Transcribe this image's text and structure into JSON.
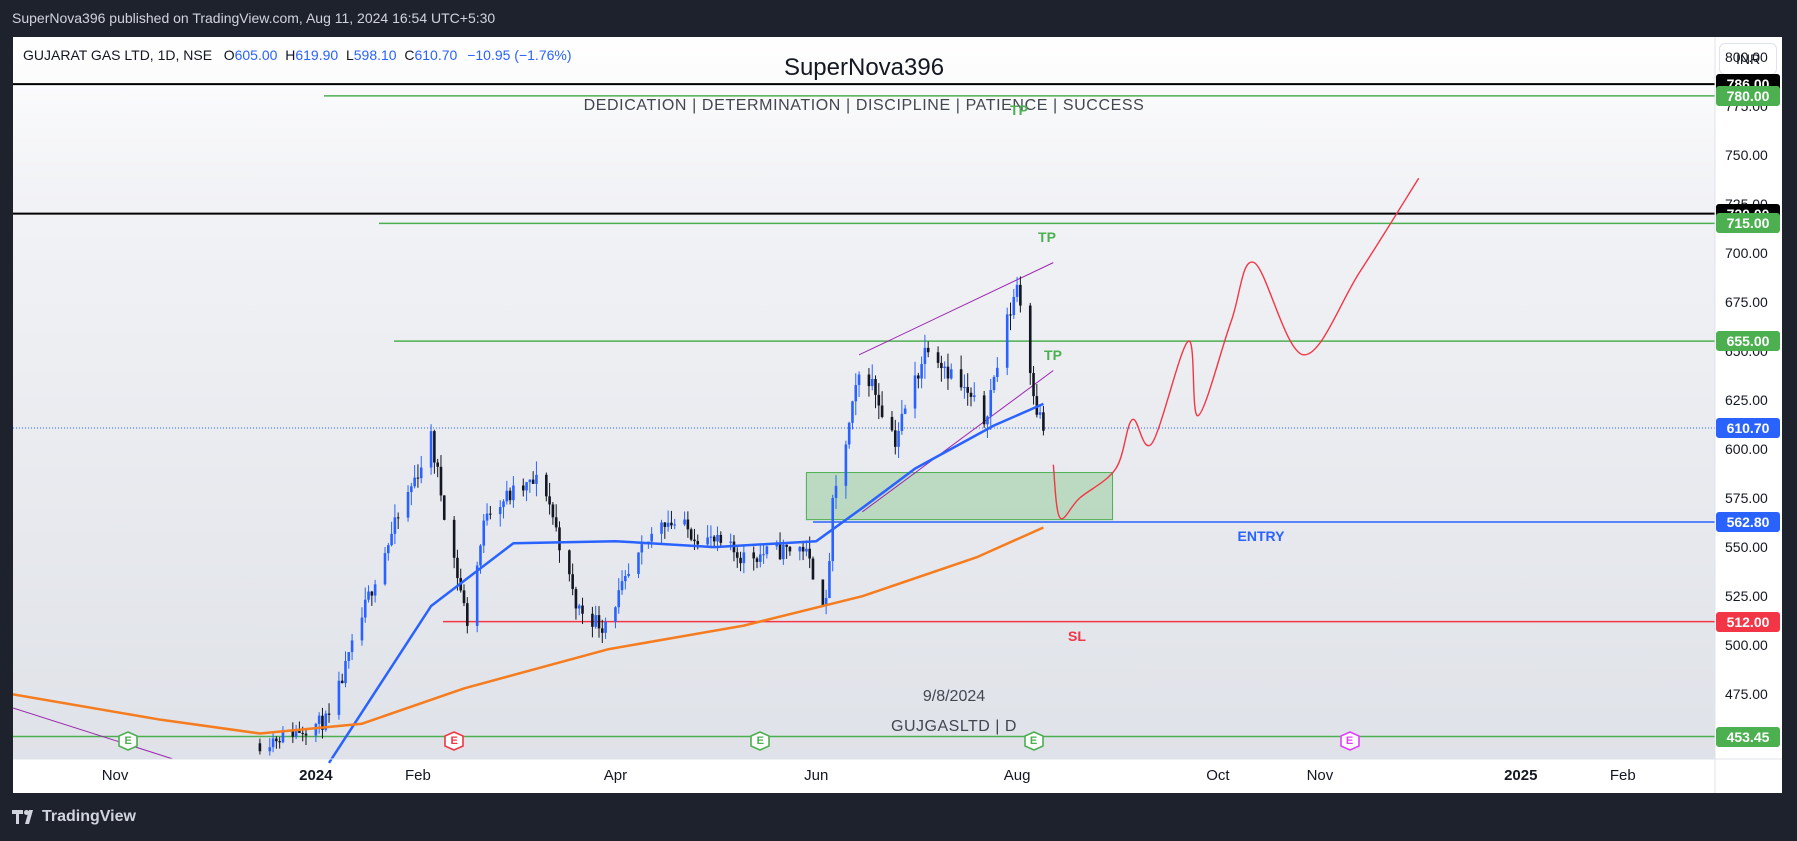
{
  "header": {
    "published": "SuperNova396 published on TradingView.com, Aug 11, 2024 16:54 UTC+5:30"
  },
  "legend": {
    "name": "GUJARAT GAS LTD, 1D, NSE",
    "o_label": "O",
    "o": "605.00",
    "h_label": "H",
    "h": "619.90",
    "l_label": "L",
    "l": "598.10",
    "c_label": "C",
    "c": "610.70",
    "change": "−10.95 (−1.76%)"
  },
  "watermark": {
    "title": "SuperNova396",
    "subtitle": "DEDICATION | DETERMINATION | DISCIPLINE | PATIENCE | SUCCESS",
    "date": "9/8/2024",
    "symbol": "GUJGASLTD | D"
  },
  "currency": "INR",
  "footer": {
    "logo_text": "TradingView"
  },
  "colors": {
    "up": "#2962ff",
    "down": "#131722",
    "ma_fast": "#2962ff",
    "ma_slow": "#f57c1f",
    "green": "#4caf50",
    "red": "#f23645",
    "purple": "#9c27b0",
    "black": "#000000"
  },
  "chart_data": {
    "type": "candlestick",
    "title": "GUJARAT GAS LTD, 1D, NSE",
    "ylim": [
      442,
      810
    ],
    "y_ticks": [
      475,
      500,
      525,
      550,
      575,
      600,
      625,
      650,
      675,
      700,
      725,
      750,
      775,
      800
    ],
    "x_ticks": [
      {
        "label": "Nov",
        "date": "2023-11-01",
        "bold": false
      },
      {
        "label": "2024",
        "date": "2024-01-01",
        "bold": true
      },
      {
        "label": "Feb",
        "date": "2024-02-01",
        "bold": false
      },
      {
        "label": "Apr",
        "date": "2024-04-01",
        "bold": false
      },
      {
        "label": "Jun",
        "date": "2024-06-01",
        "bold": false
      },
      {
        "label": "Aug",
        "date": "2024-08-01",
        "bold": false
      },
      {
        "label": "Oct",
        "date": "2024-10-01",
        "bold": false
      },
      {
        "label": "Nov",
        "date": "2024-11-01",
        "bold": false
      },
      {
        "label": "2025",
        "date": "2025-01-01",
        "bold": true
      },
      {
        "label": "Feb",
        "date": "2025-02-01",
        "bold": false
      }
    ],
    "last_close": 610.7,
    "key_points": [
      {
        "date": "2023-12-15",
        "close": 450
      },
      {
        "date": "2024-01-05",
        "close": 462
      },
      {
        "date": "2024-01-20",
        "close": 540
      },
      {
        "date": "2024-02-05",
        "close": 605
      },
      {
        "date": "2024-02-10",
        "close": 560
      },
      {
        "date": "2024-02-16",
        "close": 512
      },
      {
        "date": "2024-02-22",
        "close": 570
      },
      {
        "date": "2024-03-10",
        "close": 585
      },
      {
        "date": "2024-03-20",
        "close": 520
      },
      {
        "date": "2024-03-28",
        "close": 510
      },
      {
        "date": "2024-04-15",
        "close": 565
      },
      {
        "date": "2024-05-10",
        "close": 545
      },
      {
        "date": "2024-05-28",
        "close": 550
      },
      {
        "date": "2024-06-04",
        "close": 520
      },
      {
        "date": "2024-06-06",
        "close": 570
      },
      {
        "date": "2024-06-15",
        "close": 645
      },
      {
        "date": "2024-06-25",
        "close": 605
      },
      {
        "date": "2024-07-05",
        "close": 655
      },
      {
        "date": "2024-07-22",
        "close": 615
      },
      {
        "date": "2024-08-01",
        "close": 685
      },
      {
        "date": "2024-08-07",
        "close": 621
      },
      {
        "date": "2024-08-09",
        "close": 610.7
      }
    ],
    "moving_averages": [
      {
        "color": "#2962ff",
        "points": [
          {
            "date": "2024-01-05",
            "value": 440
          },
          {
            "date": "2024-02-05",
            "value": 520
          },
          {
            "date": "2024-03-01",
            "value": 552
          },
          {
            "date": "2024-04-01",
            "value": 553
          },
          {
            "date": "2024-05-01",
            "value": 550
          },
          {
            "date": "2024-06-01",
            "value": 553
          },
          {
            "date": "2024-06-15",
            "value": 570
          },
          {
            "date": "2024-07-01",
            "value": 590
          },
          {
            "date": "2024-07-25",
            "value": 612
          },
          {
            "date": "2024-08-09",
            "value": 623
          }
        ]
      },
      {
        "color": "#f57c1f",
        "points": [
          {
            "date": "2023-10-01",
            "value": 475
          },
          {
            "date": "2023-11-15",
            "value": 462
          },
          {
            "date": "2023-12-15",
            "value": 455
          },
          {
            "date": "2024-01-15",
            "value": 460
          },
          {
            "date": "2024-02-15",
            "value": 478
          },
          {
            "date": "2024-03-30",
            "value": 498
          },
          {
            "date": "2024-05-10",
            "value": 510
          },
          {
            "date": "2024-06-15",
            "value": 525
          },
          {
            "date": "2024-07-20",
            "value": 545
          },
          {
            "date": "2024-08-09",
            "value": 560
          }
        ]
      }
    ],
    "horizontal_levels": [
      {
        "value": 786.0,
        "label": "786.00",
        "color": "#000000",
        "label_bg": "#000000"
      },
      {
        "value": 780.0,
        "label": "780.00",
        "color": "#4caf50",
        "label_bg": "#4caf50",
        "annotation": "TP"
      },
      {
        "value": 720.0,
        "label": "720.00",
        "color": "#000000",
        "label_bg": "#000000"
      },
      {
        "value": 715.0,
        "label": "715.00",
        "color": "#4caf50",
        "label_bg": "#4caf50",
        "annotation": "TP"
      },
      {
        "value": 655.0,
        "label": "655.00",
        "color": "#4caf50",
        "label_bg": "#4caf50",
        "annotation": "TP"
      },
      {
        "value": 610.7,
        "label": "610.70",
        "color": "#2962ff",
        "label_bg": "#2962ff"
      },
      {
        "value": 562.8,
        "label": "562.80",
        "color": "#2962ff",
        "label_bg": "#2962ff",
        "annotation": "ENTRY"
      },
      {
        "value": 512.0,
        "label": "512.00",
        "color": "#f23645",
        "label_bg": "#f23645",
        "annotation": "SL"
      },
      {
        "value": 453.45,
        "label": "453.45",
        "color": "#4caf50",
        "label_bg": "#4caf50"
      }
    ],
    "demand_zone": {
      "from_date": "2024-05-29",
      "to_date": "2024-08-30",
      "low": 564,
      "high": 588
    },
    "channel": {
      "upper": [
        {
          "date": "2024-06-14",
          "value": 648
        },
        {
          "date": "2024-08-12",
          "value": 695
        }
      ],
      "lower": [
        {
          "date": "2024-06-15",
          "value": 568
        },
        {
          "date": "2024-08-12",
          "value": 640
        }
      ]
    },
    "projection": [
      {
        "date": "2024-08-12",
        "value": 592
      },
      {
        "date": "2024-08-14",
        "value": 565
      },
      {
        "date": "2024-08-20",
        "value": 575
      },
      {
        "date": "2024-08-31",
        "value": 590
      },
      {
        "date": "2024-09-05",
        "value": 615
      },
      {
        "date": "2024-09-11",
        "value": 603
      },
      {
        "date": "2024-09-22",
        "value": 655
      },
      {
        "date": "2024-09-25",
        "value": 617
      },
      {
        "date": "2024-10-05",
        "value": 665
      },
      {
        "date": "2024-10-12",
        "value": 695
      },
      {
        "date": "2024-10-27",
        "value": 648
      },
      {
        "date": "2024-11-13",
        "value": 690
      },
      {
        "date": "2024-12-01",
        "value": 738
      }
    ],
    "earnings": [
      {
        "date": "2023-11-05",
        "color": "#4caf50",
        "label": "E"
      },
      {
        "date": "2024-02-12",
        "color": "#f23645",
        "label": "E"
      },
      {
        "date": "2024-05-15",
        "color": "#4caf50",
        "label": "E"
      },
      {
        "date": "2024-08-06",
        "color": "#4caf50",
        "label": "E"
      },
      {
        "date": "2024-11-10",
        "color": "#e040fb",
        "label": "E"
      }
    ]
  }
}
